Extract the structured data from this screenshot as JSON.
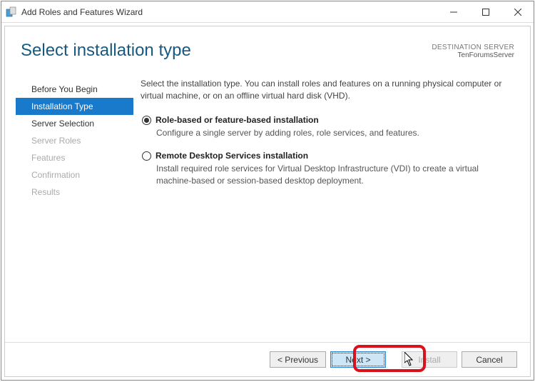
{
  "window": {
    "title": "Add Roles and Features Wizard"
  },
  "header": {
    "page_title": "Select installation type",
    "dest_label": "DESTINATION SERVER",
    "dest_server": "TenForumsServer"
  },
  "sidebar": {
    "steps": [
      {
        "label": "Before You Begin",
        "state": "enabled"
      },
      {
        "label": "Installation Type",
        "state": "active"
      },
      {
        "label": "Server Selection",
        "state": "enabled"
      },
      {
        "label": "Server Roles",
        "state": "disabled"
      },
      {
        "label": "Features",
        "state": "disabled"
      },
      {
        "label": "Confirmation",
        "state": "disabled"
      },
      {
        "label": "Results",
        "state": "disabled"
      }
    ]
  },
  "main": {
    "intro": "Select the installation type. You can install roles and features on a running physical computer or virtual machine, or on an offline virtual hard disk (VHD).",
    "options": [
      {
        "label": "Role-based or feature-based installation",
        "desc": "Configure a single server by adding roles, role services, and features.",
        "selected": true
      },
      {
        "label": "Remote Desktop Services installation",
        "desc": "Install required role services for Virtual Desktop Infrastructure (VDI) to create a virtual machine-based or session-based desktop deployment.",
        "selected": false
      }
    ]
  },
  "footer": {
    "previous": "< Previous",
    "next": "Next >",
    "install": "Install",
    "cancel": "Cancel"
  }
}
